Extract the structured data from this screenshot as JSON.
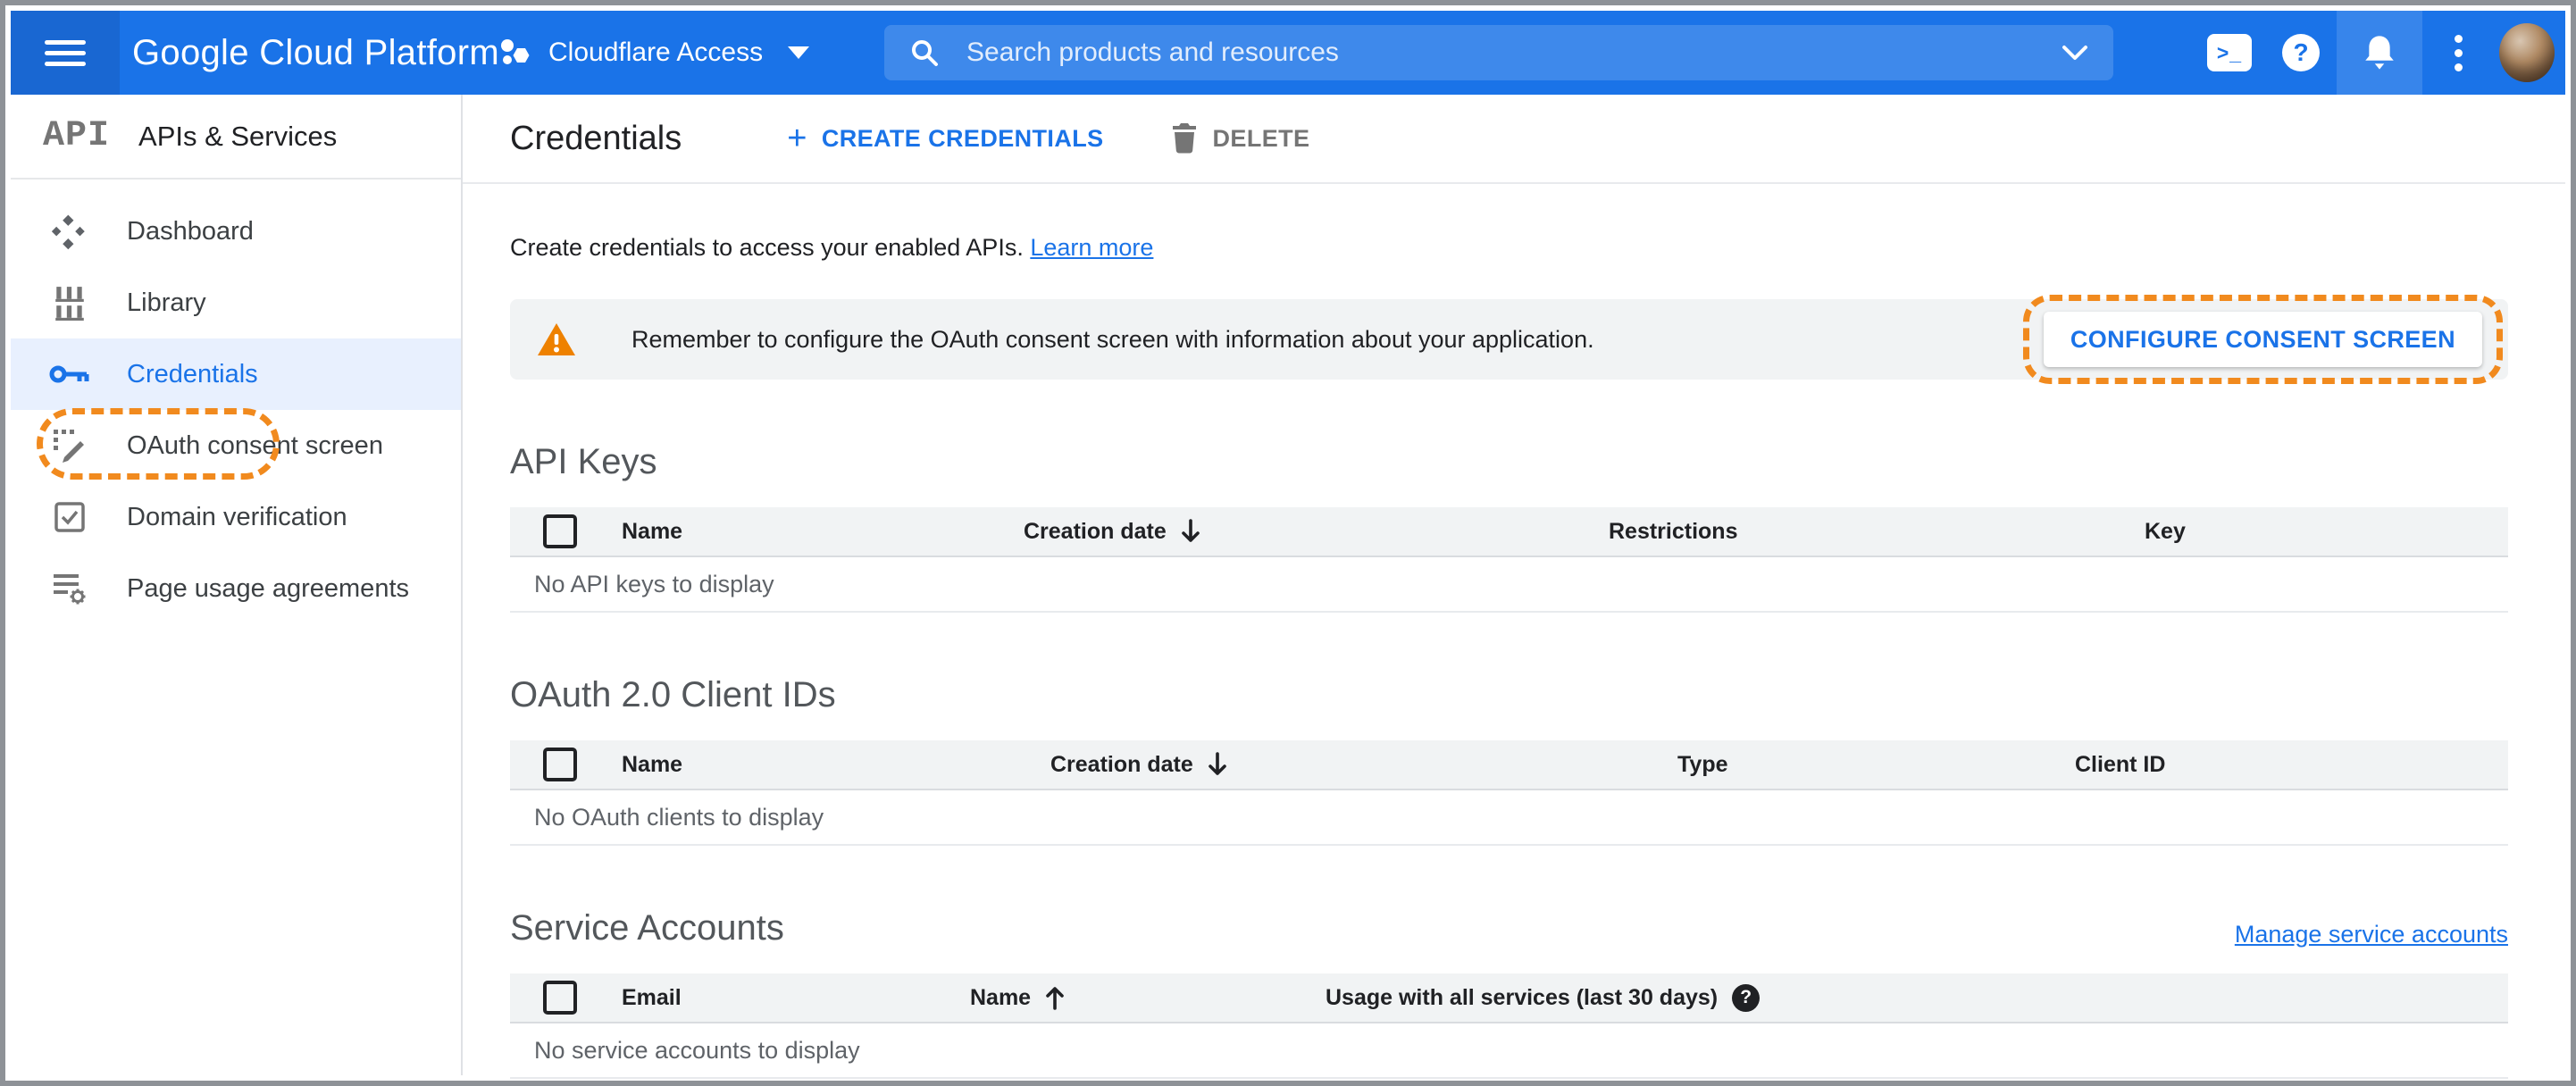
{
  "topbar": {
    "brand": "Google Cloud Platform",
    "project_name": "Cloudflare Access",
    "search_placeholder": "Search products and resources",
    "cloud_shell_glyph": ">_",
    "help_glyph": "?"
  },
  "sidebar": {
    "logo": "API",
    "title": "APIs & Services",
    "items": [
      "Dashboard",
      "Library",
      "Credentials",
      "OAuth consent screen",
      "Domain verification",
      "Page usage agreements"
    ],
    "active_item": "Credentials"
  },
  "header": {
    "title": "Credentials",
    "create_plus": "+",
    "create_label": "CREATE CREDENTIALS",
    "delete_label": "DELETE"
  },
  "intro": {
    "text": "Create credentials to access your enabled APIs.",
    "link_label": "Learn more"
  },
  "banner": {
    "message": "Remember to configure the OAuth consent screen with information about your application.",
    "button_label": "CONFIGURE CONSENT SCREEN"
  },
  "api_keys": {
    "title": "API Keys",
    "columns": [
      "Name",
      "Creation date",
      "Restrictions",
      "Key"
    ],
    "sort": {
      "column": "Creation date",
      "direction": "desc"
    },
    "empty": "No API keys to display"
  },
  "oauth_clients": {
    "title": "OAuth 2.0 Client IDs",
    "columns": [
      "Name",
      "Creation date",
      "Type",
      "Client ID"
    ],
    "sort": {
      "column": "Creation date",
      "direction": "desc"
    },
    "empty": "No OAuth clients to display"
  },
  "service_accounts": {
    "title": "Service Accounts",
    "link_label": "Manage service accounts",
    "columns": [
      "Email",
      "Name",
      "Usage with all services (last 30 days)"
    ],
    "sort": {
      "column": "Name",
      "direction": "asc"
    },
    "help_glyph": "?",
    "empty": "No service accounts to display"
  },
  "colors": {
    "topbar_blue": "#1a73e8",
    "topbar_strip_blue": "#1967d2",
    "accent_blue": "#1a73e8",
    "annotation_orange": "#f18a1e",
    "warning_orange": "#ee8100",
    "selected_item_bg": "#e8f0fe",
    "banner_bg": "#f1f3f4"
  }
}
